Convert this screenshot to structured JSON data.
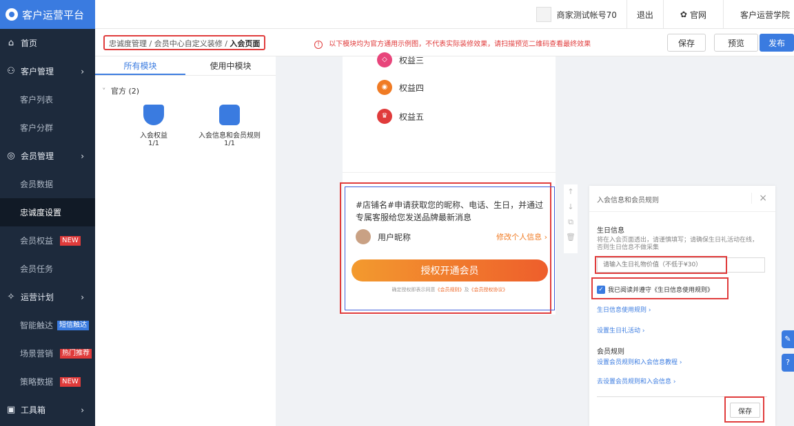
{
  "app": {
    "title": "客户运营平台"
  },
  "topbar": {
    "account": "商家测试帐号70",
    "logout": "退出",
    "official_site": "官网",
    "academy": "客户运营学院"
  },
  "sidebar": {
    "items": [
      {
        "label": "首页",
        "icon": "home-icon"
      },
      {
        "label": "客户管理",
        "icon": "people-icon"
      },
      {
        "label": "客户列表"
      },
      {
        "label": "客户分群"
      },
      {
        "label": "会员管理",
        "icon": "member-icon"
      },
      {
        "label": "会员数据"
      },
      {
        "label": "忠诚度设置"
      },
      {
        "label": "会员权益",
        "tag": "NEW"
      },
      {
        "label": "会员任务"
      },
      {
        "label": "运营计划",
        "icon": "bulb-icon"
      },
      {
        "label": "智能触达",
        "tag": "短信触达"
      },
      {
        "label": "场景营销",
        "tag": "热门推荐"
      },
      {
        "label": "策略数据",
        "tag": "NEW"
      },
      {
        "label": "工具箱",
        "icon": "toolbox-icon"
      }
    ]
  },
  "subheader": {
    "breadcrumb": [
      "忠诚度管理",
      "会员中心自定义装修",
      "入会页面"
    ],
    "notice": "以下模块均为官方通用示例图，不代表实际装修效果，请扫描预览二维码查看最终效果",
    "save": "保存",
    "preview": "预览",
    "publish": "发布"
  },
  "modules": {
    "tabs": [
      "所有模块",
      "使用中模块"
    ],
    "group": "官方 (2)",
    "items": [
      {
        "name": "入会权益",
        "count": "1/1"
      },
      {
        "name": "入会信息和会员规则",
        "count": "1/1"
      }
    ]
  },
  "preview": {
    "benefits": [
      "权益三",
      "权益四",
      "权益五"
    ],
    "join_text": "#店铺名#申请获取您的昵称、电话、生日，并通过专属客服给您发送品牌最新消息",
    "user_name": "用户昵称",
    "edit_link": "修改个人信息 ›",
    "auth_button": "授权开通会员",
    "agree_prefix": "确定授权即表示同意",
    "agree_link1": "《会员规则》",
    "agree_mid": "及",
    "agree_link2": "《会员授权协议》"
  },
  "settings": {
    "title": "入会信息和会员规则",
    "birthday_label": "生日信息",
    "birthday_desc": "将在入会页面透出，请谨慎填写；请确保生日礼活动在线，否则生日信息不做采集",
    "input_placeholder": "请输入生日礼物价值（不低于¥30）",
    "checkbox_label": "我已阅读并遵守《生日信息使用规则》",
    "link_rules": "生日信息使用规则 ›",
    "link_gift": "设置生日礼活动 ›",
    "member_rules_label": "会员规则",
    "link_tutorial": "设置会员规则和入会信息教程 ›",
    "link_go": "去设置会员规则和入会信息 ›",
    "save": "保存"
  }
}
